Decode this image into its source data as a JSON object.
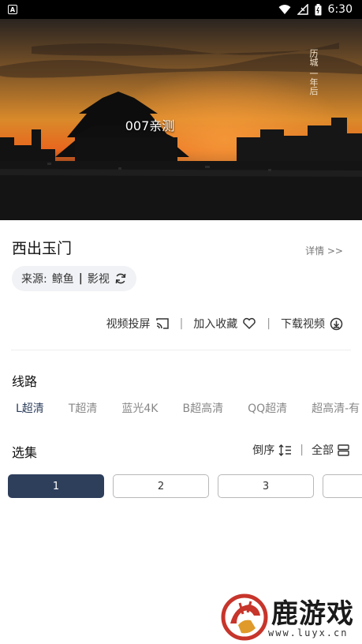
{
  "status_bar": {
    "time": "6:30"
  },
  "player": {
    "caption": "007亲测",
    "poem": "历城 一年后"
  },
  "detail": {
    "title": "西出玉门",
    "detail_link": "详情 >>",
    "source_label": "来源:",
    "source_name": "鲸鱼",
    "source_sep": "|",
    "source_type": "影视"
  },
  "actions": {
    "cast": "视频投屏",
    "favorite": "加入收藏",
    "download": "下载视频",
    "separator": "|"
  },
  "lines": {
    "title": "线路",
    "items": [
      "L超清",
      "T超清",
      "蓝光4K",
      "B超高清",
      "QQ超清",
      "超高清-有"
    ],
    "active_index": 0
  },
  "episodes": {
    "title": "选集",
    "sort_label": "倒序",
    "all_label": "全部",
    "separator": "|",
    "items": [
      "1",
      "2",
      "3",
      ""
    ],
    "active_index": 0
  },
  "watermark": {
    "brand": "鹿游戏",
    "url": "www.luyx.cn"
  },
  "colors": {
    "accent": "#2e3f5c",
    "status_bar": "#000000"
  }
}
